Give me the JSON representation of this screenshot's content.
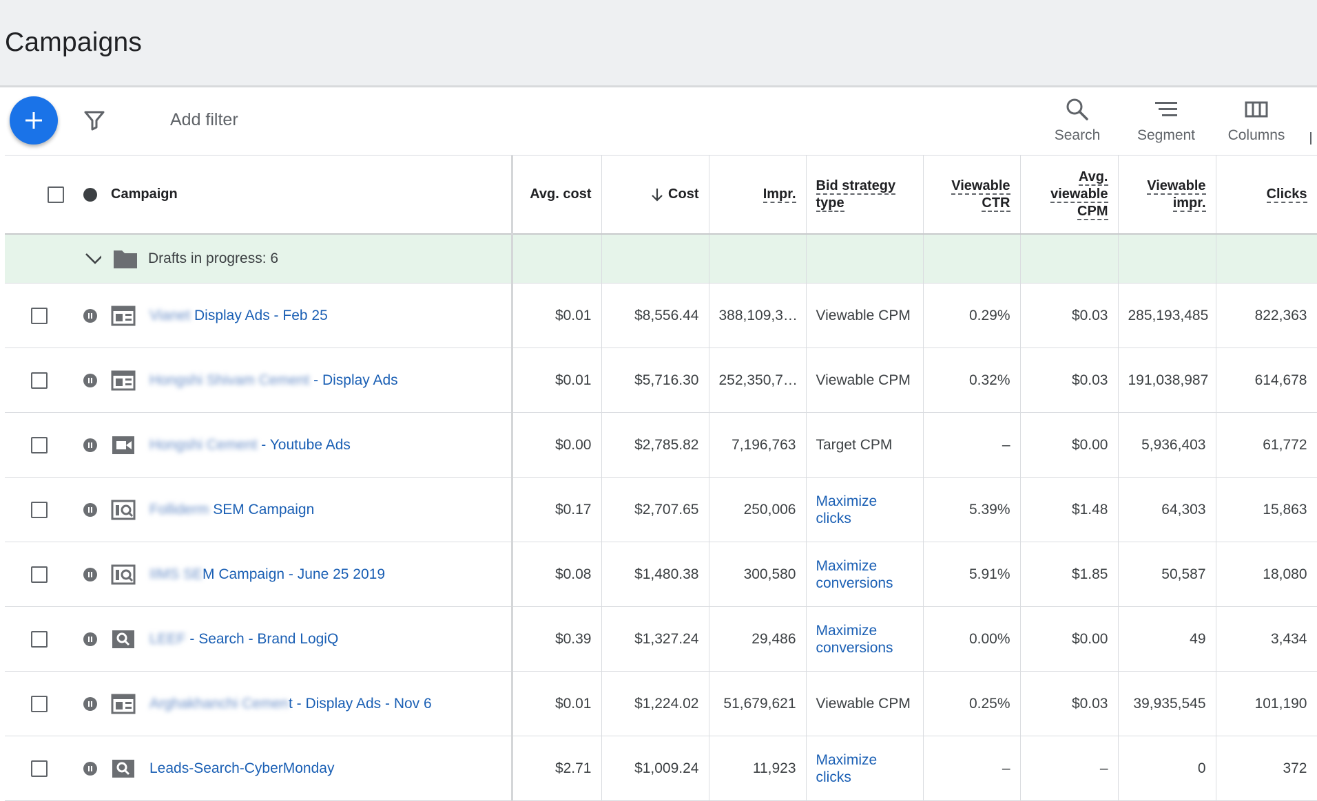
{
  "page": {
    "title": "Campaigns"
  },
  "toolbar": {
    "add_filter": "Add filter",
    "search_label": "Search",
    "segment_label": "Segment",
    "columns_label": "Columns"
  },
  "table": {
    "headers": {
      "campaign": "Campaign",
      "avg_cost": "Avg. cost",
      "cost": "Cost",
      "impr": "Impr.",
      "bid_strategy_line1": "Bid strategy",
      "bid_strategy_line2": "type",
      "viewable_ctr_line1": "Viewable",
      "viewable_ctr_line2": "CTR",
      "avg_viewable_cpm_line1": "Avg.",
      "avg_viewable_cpm_line2": "viewable",
      "avg_viewable_cpm_line3": "CPM",
      "viewable_impr_line1": "Viewable",
      "viewable_impr_line2": "impr.",
      "clicks": "Clicks"
    },
    "drafts": {
      "label": "Drafts in progress: 6"
    },
    "rows": [
      {
        "type": "display",
        "name_blur": "Vianet",
        "name": " Display Ads - Feb 25",
        "avg_cost": "$0.01",
        "cost": "$8,556.44",
        "impr": "388,109,3…",
        "bid": "Viewable CPM",
        "bid_link": false,
        "vctr": "0.29%",
        "avcpm": "$0.03",
        "vimpr": "285,193,485",
        "clicks": "822,363"
      },
      {
        "type": "display",
        "name_blur": "Hongshi Shivam Cement",
        "name": " - Display Ads",
        "avg_cost": "$0.01",
        "cost": "$5,716.30",
        "impr": "252,350,7…",
        "bid": "Viewable CPM",
        "bid_link": false,
        "vctr": "0.32%",
        "avcpm": "$0.03",
        "vimpr": "191,038,987",
        "clicks": "614,678"
      },
      {
        "type": "video",
        "name_blur": "Hongshi Cement",
        "name": " - Youtube Ads",
        "avg_cost": "$0.00",
        "cost": "$2,785.82",
        "impr": "7,196,763",
        "bid": "Target CPM",
        "bid_link": false,
        "vctr": "–",
        "avcpm": "$0.00",
        "vimpr": "5,936,403",
        "clicks": "61,772"
      },
      {
        "type": "search-display",
        "name_blur": "Folliderm",
        "name": " SEM Campaign",
        "avg_cost": "$0.17",
        "cost": "$2,707.65",
        "impr": "250,006",
        "bid": "Maximize clicks",
        "bid_link": true,
        "vctr": "5.39%",
        "avcpm": "$1.48",
        "vimpr": "64,303",
        "clicks": "15,863"
      },
      {
        "type": "search-display",
        "name_blur": "IIMS SE",
        "name": "M Campaign - June 25 2019",
        "avg_cost": "$0.08",
        "cost": "$1,480.38",
        "impr": "300,580",
        "bid": "Maximize conversions",
        "bid_link": true,
        "vctr": "5.91%",
        "avcpm": "$1.85",
        "vimpr": "50,587",
        "clicks": "18,080"
      },
      {
        "type": "search",
        "name_blur": "LEEF",
        "name": " - Search - Brand LogiQ",
        "avg_cost": "$0.39",
        "cost": "$1,327.24",
        "impr": "29,486",
        "bid": "Maximize conversions",
        "bid_link": true,
        "vctr": "0.00%",
        "avcpm": "$0.00",
        "vimpr": "49",
        "clicks": "3,434"
      },
      {
        "type": "display",
        "name_blur": "Arghakhanchi Cemen",
        "name": "t - Display Ads - Nov 6",
        "avg_cost": "$0.01",
        "cost": "$1,224.02",
        "impr": "51,679,621",
        "bid": "Viewable CPM",
        "bid_link": false,
        "vctr": "0.25%",
        "avcpm": "$0.03",
        "vimpr": "39,935,545",
        "clicks": "101,190"
      },
      {
        "type": "search",
        "name_blur": "",
        "name": "Leads-Search-CyberMonday",
        "avg_cost": "$2.71",
        "cost": "$1,009.24",
        "impr": "11,923",
        "bid": "Maximize clicks",
        "bid_link": true,
        "vctr": "–",
        "avcpm": "–",
        "vimpr": "0",
        "clicks": "372"
      }
    ]
  },
  "colors": {
    "accent": "#1a73e8",
    "link": "#1a5fb4",
    "drafts_bg": "#e6f4ea"
  }
}
